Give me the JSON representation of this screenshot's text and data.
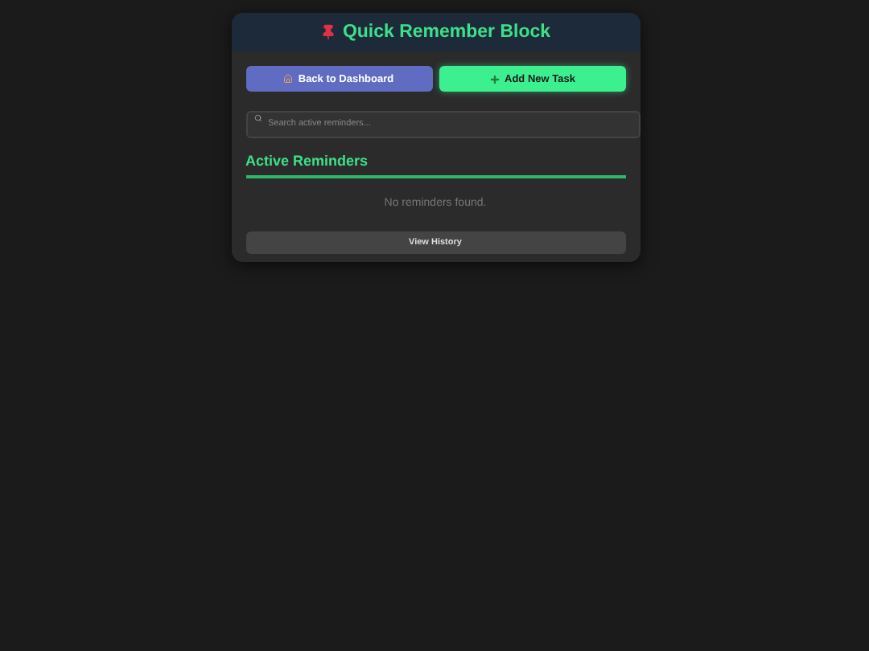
{
  "header": {
    "title": "Quick Remember Block"
  },
  "buttons": [
    {
      "label": "Back to Dashboard",
      "kind": "back"
    },
    {
      "label": "Add New Task",
      "kind": "add"
    }
  ],
  "search": {
    "placeholder": "Search active reminders..."
  },
  "section": {
    "title": "Active Reminders",
    "empty_message": "No reminders found."
  },
  "footer_button": "View History"
}
